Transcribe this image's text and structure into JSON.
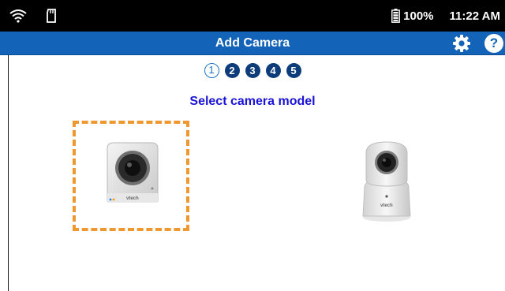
{
  "status_bar": {
    "battery": "100%",
    "time": "11:22 AM",
    "icons": [
      "wifi-icon",
      "sd-card-icon",
      "battery-icon"
    ]
  },
  "header": {
    "title": "Add Camera",
    "icons": [
      "gear-icon",
      "help-icon"
    ],
    "help_label": "?",
    "background": "#1363b8"
  },
  "steps": [
    {
      "label": "1",
      "state": "current"
    },
    {
      "label": "2",
      "state": "pending"
    },
    {
      "label": "3",
      "state": "pending"
    },
    {
      "label": "4",
      "state": "pending"
    },
    {
      "label": "5",
      "state": "pending"
    }
  ],
  "select_title": "Select camera model",
  "cameras": [
    {
      "brand": "vtech",
      "selected": true
    },
    {
      "brand": "vtech",
      "selected": false
    }
  ],
  "colors": {
    "title": "#1a14d6",
    "selection": "#f09830",
    "step_pending": "#0d3c7a"
  }
}
